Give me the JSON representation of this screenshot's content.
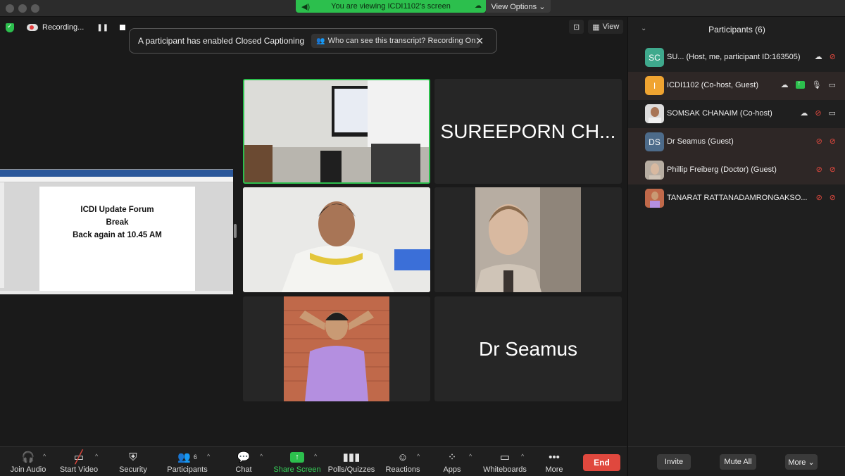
{
  "titlebar": {
    "viewing_banner": "You are viewing ICDI1102's screen",
    "view_options": "View Options ⌄"
  },
  "recording": {
    "label": "Recording..."
  },
  "caption": {
    "message": "A participant has enabled Closed Captioning",
    "who": "Who can see this transcript? Recording On"
  },
  "view_button": "View",
  "shared_doc": {
    "lines": [
      "ICDI Update Forum",
      "Break",
      "Back again at 10.45 AM"
    ]
  },
  "tiles": {
    "name_tile_1": "SUREEPORN CH...",
    "name_tile_2": "Dr Seamus"
  },
  "participants": {
    "title": "Participants (6)",
    "rows": [
      {
        "initials": "SC",
        "name": "SU... (Host, me, participant ID:163505)",
        "avatar_color": "#3fa98d"
      },
      {
        "initials": "I",
        "name": "ICDI1102 (Co-host, Guest)",
        "avatar_color": "#f0a431"
      },
      {
        "initials": "",
        "name": "SOMSAK CHANAIM (Co-host)",
        "avatar_color": "#6b7b8c"
      },
      {
        "initials": "DS",
        "name": "Dr Seamus (Guest)",
        "avatar_color": "#4d6b8a"
      },
      {
        "initials": "",
        "name": "Phillip Freiberg (Doctor) (Guest)",
        "avatar_color": "#a08c76"
      },
      {
        "initials": "",
        "name": "TANARAT RATTANADAMRONGAKSO...",
        "avatar_color": "#c96b5a"
      }
    ],
    "invite": "Invite",
    "mute_all": "Mute All",
    "more": "More ⌄"
  },
  "toolbar": {
    "join_audio": "Join Audio",
    "start_video": "Start Video",
    "security": "Security",
    "participants": "Participants",
    "participants_count": "6",
    "chat": "Chat",
    "share_screen": "Share Screen",
    "polls": "Polls/Quizzes",
    "reactions": "Reactions",
    "apps": "Apps",
    "whiteboards": "Whiteboards",
    "more": "More",
    "end": "End"
  },
  "colors": {
    "accent_green": "#2cbf4d",
    "end_red": "#e0483e",
    "background": "#1a1a1a"
  }
}
